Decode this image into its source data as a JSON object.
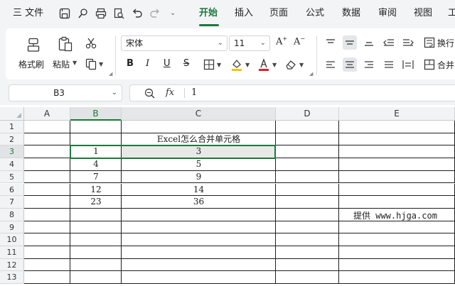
{
  "menubar": {
    "menu_label": "三 文件",
    "tabs": [
      "开始",
      "插入",
      "页面",
      "公式",
      "数据",
      "审阅",
      "视图",
      "工"
    ],
    "active_tab": "开始",
    "accent_color": "#1a7a3a"
  },
  "ribbon": {
    "format_painter": "格式刷",
    "paste": "粘贴",
    "font_name": "宋体",
    "font_size": "11",
    "wrap_text": "换行",
    "merge": "合并",
    "icons": [
      "format-painter-icon",
      "paste-icon",
      "cut-icon",
      "copy-icon",
      "bold-icon",
      "italic-icon",
      "underline-icon",
      "strikethrough-icon",
      "borders-icon",
      "fill-color-icon",
      "font-color-icon",
      "clear-icon",
      "increase-font-icon",
      "decrease-font-icon",
      "align-top-icon",
      "align-middle-icon",
      "align-bottom-icon",
      "indent-left-icon",
      "indent-right-icon",
      "align-left-icon",
      "align-center-icon",
      "align-right-icon",
      "distribute-icon"
    ],
    "fill_color": "#f5c400",
    "font_color": "#e0202a"
  },
  "formula_bar": {
    "name_box": "B3",
    "fx": "fx",
    "value": "1"
  },
  "sheet": {
    "columns": [
      "A",
      "B",
      "C",
      "D",
      "E"
    ],
    "selected_column": "B",
    "rows": [
      "1",
      "2",
      "3",
      "4",
      "5",
      "6",
      "7",
      "8",
      "9",
      "10",
      "11",
      "12",
      "13"
    ],
    "selected_row": "3",
    "title_cell": "Excel怎么合并单元格",
    "table": [
      [
        "1",
        "3"
      ],
      [
        "4",
        "5"
      ],
      [
        "7",
        "9"
      ],
      [
        "12",
        "14"
      ],
      [
        "23",
        "36"
      ]
    ],
    "watermark": "提供 www.hjga.com"
  }
}
